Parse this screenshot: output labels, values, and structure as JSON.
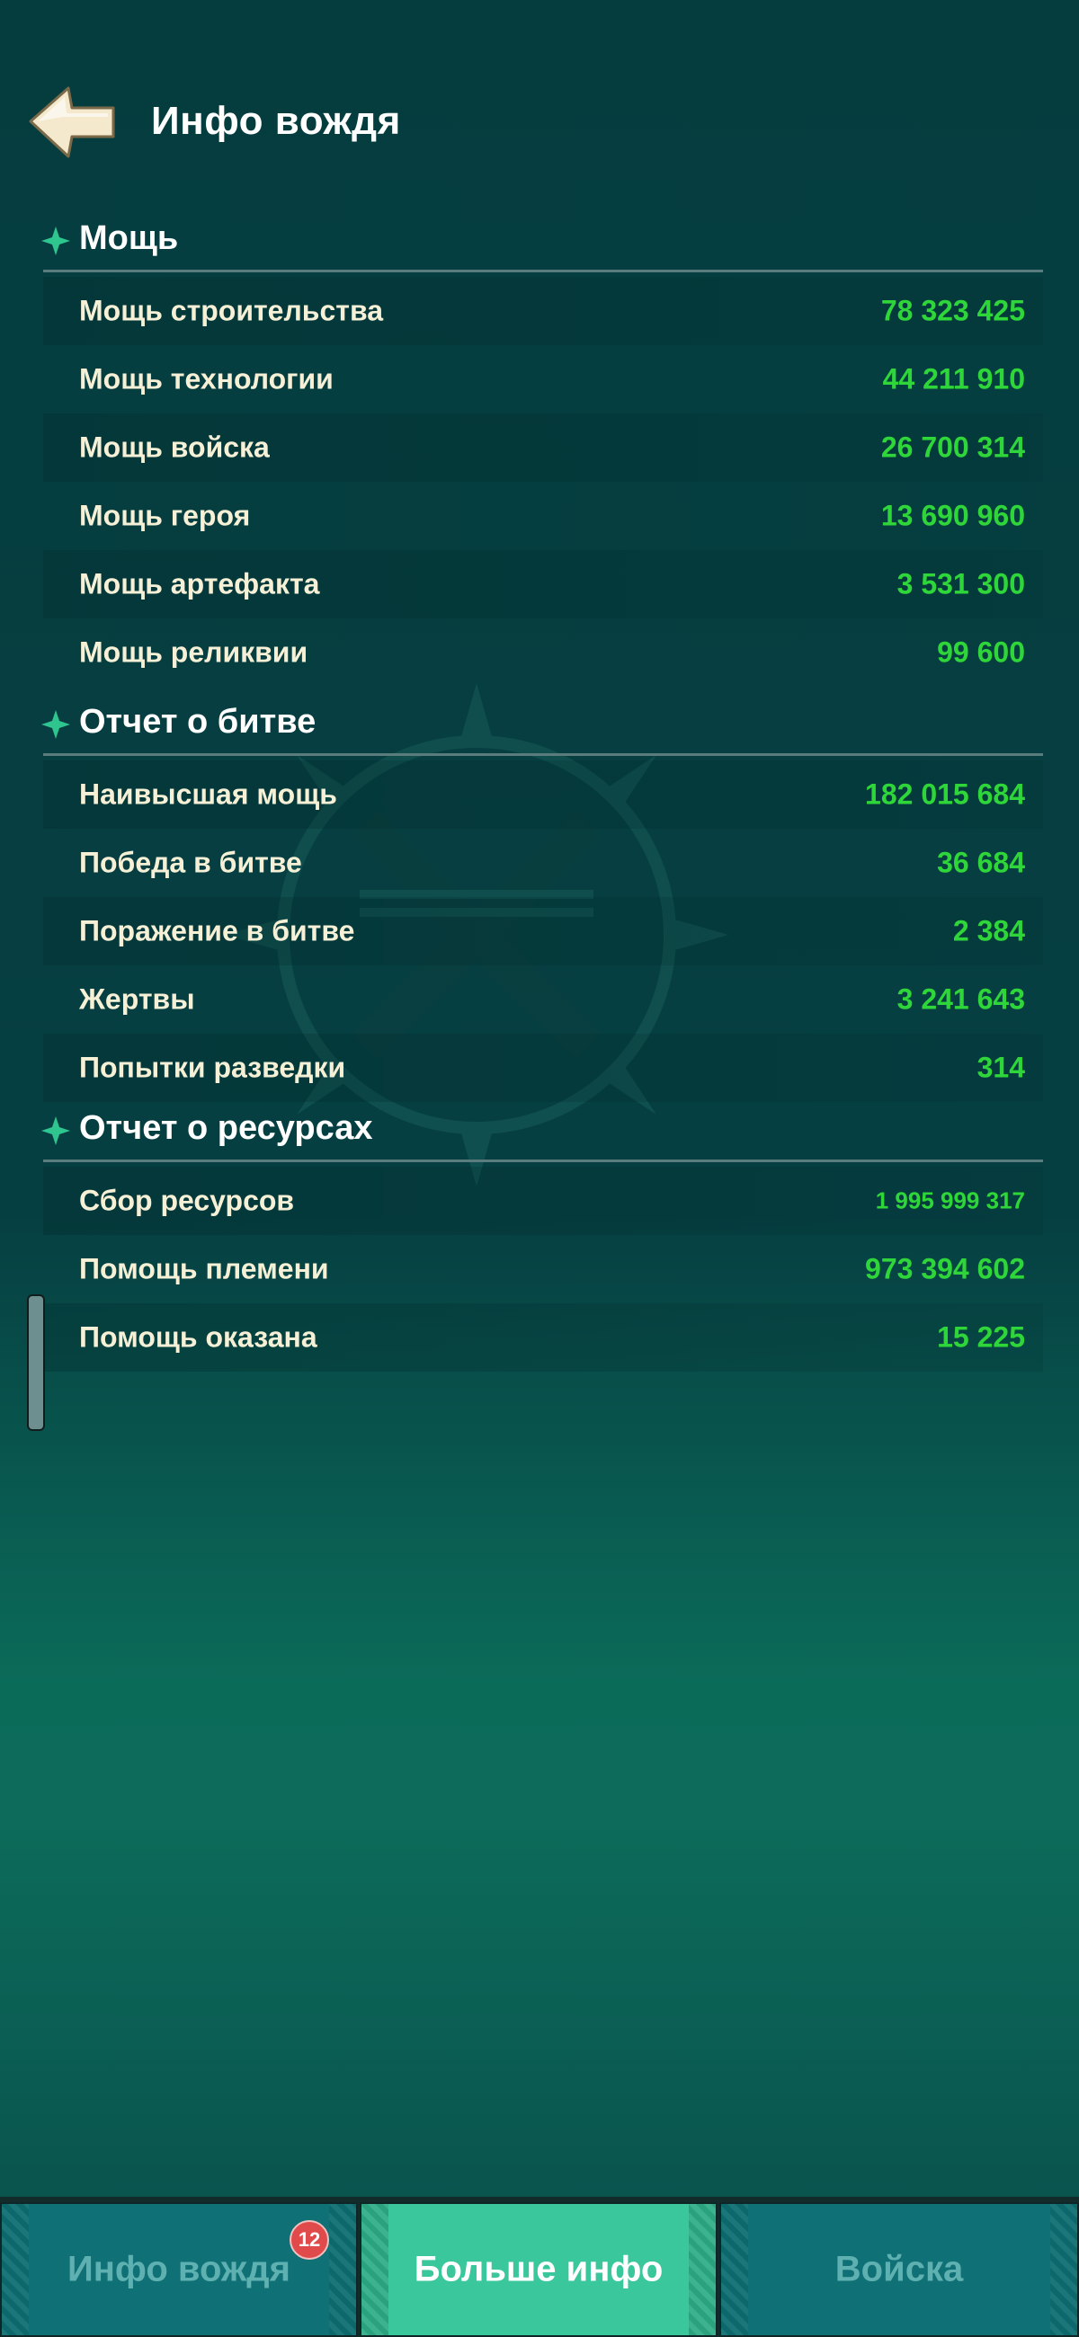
{
  "header": {
    "title": "Инфо вождя"
  },
  "sections": [
    {
      "title": "Мощь",
      "rows": [
        {
          "label": "Мощь строительства",
          "value": "78 323 425"
        },
        {
          "label": "Мощь технологии",
          "value": "44 211 910"
        },
        {
          "label": "Мощь войска",
          "value": "26 700 314"
        },
        {
          "label": "Мощь героя",
          "value": "13 690 960"
        },
        {
          "label": "Мощь артефакта",
          "value": "3 531 300"
        },
        {
          "label": "Мощь реликвии",
          "value": "99 600"
        }
      ]
    },
    {
      "title": "Отчет о битве",
      "rows": [
        {
          "label": "Наивысшая мощь",
          "value": "182 015 684"
        },
        {
          "label": "Победа в битве",
          "value": "36 684"
        },
        {
          "label": "Поражение в битве",
          "value": "2 384"
        },
        {
          "label": "Жертвы",
          "value": "3 241 643"
        },
        {
          "label": "Попытки разведки",
          "value": "314"
        }
      ]
    },
    {
      "title": "Отчет о ресурсах",
      "rows": [
        {
          "label": "Сбор ресурсов",
          "value": "1 995 999 317"
        },
        {
          "label": "Помощь племени",
          "value": "973 394 602"
        },
        {
          "label": "Помощь оказана",
          "value": "15 225"
        }
      ]
    }
  ],
  "tabs": [
    {
      "label": "Инфо вождя",
      "badge": "12"
    },
    {
      "label": "Больше инфо"
    },
    {
      "label": "Войска"
    }
  ],
  "colors": {
    "value": "#2fd63a",
    "label": "#f6f0d6",
    "accent": "#39c79b"
  }
}
